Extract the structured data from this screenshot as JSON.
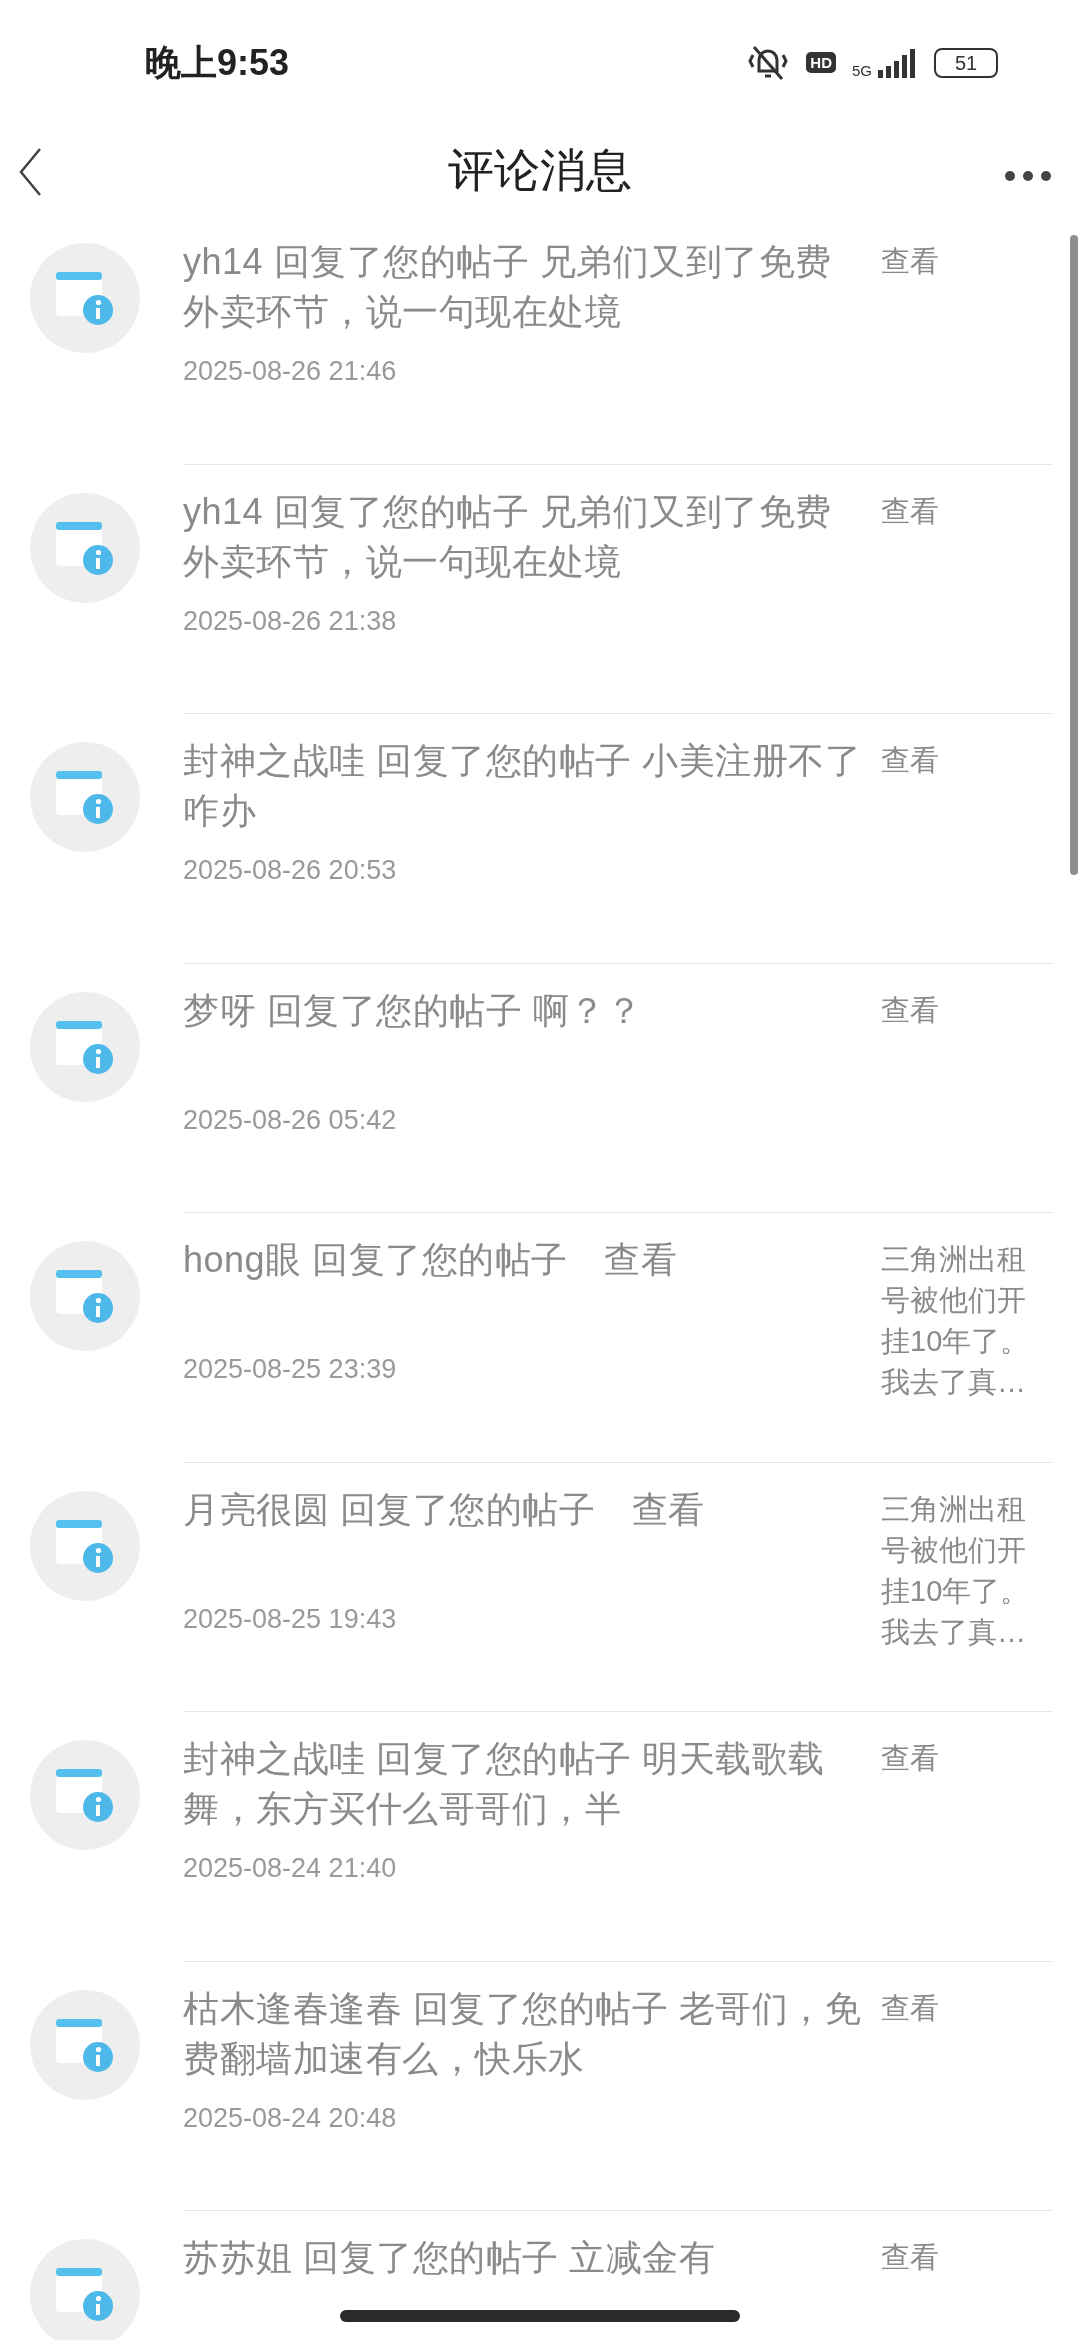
{
  "status_bar": {
    "time": "晚上9:53",
    "hd": "HD",
    "network": "5G",
    "battery": "51"
  },
  "header": {
    "title": "评论消息"
  },
  "messages": [
    {
      "text": "yh14 回复了您的帖子 兄弟们又到了免费外卖环节，说一句现在处境",
      "date": "2025-08-26 21:46",
      "side": "查看"
    },
    {
      "text": "yh14 回复了您的帖子 兄弟们又到了免费外卖环节，说一句现在处境",
      "date": "2025-08-26 21:38",
      "side": "查看"
    },
    {
      "text": "封神之战哇 回复了您的帖子 小美注册不了咋办",
      "date": "2025-08-26 20:53",
      "side": "查看"
    },
    {
      "text": "梦呀 回复了您的帖子 啊？？",
      "date": "2025-08-26 05:42",
      "side": "查看"
    },
    {
      "text": "hong眼 回复了您的帖子　查看",
      "date": "2025-08-25 23:39",
      "side": "三角洲出租号被他们开挂10年了。我去了真…"
    },
    {
      "text": "月亮很圆 回复了您的帖子　查看",
      "date": "2025-08-25 19:43",
      "side": "三角洲出租号被他们开挂10年了。我去了真…"
    },
    {
      "text": "封神之战哇 回复了您的帖子 明天载歌载舞，东方买什么哥哥们，半",
      "date": "2025-08-24 21:40",
      "side": "查看"
    },
    {
      "text": "枯木逢春逢春 回复了您的帖子 老哥们，免费翻墙加速有么，快乐水",
      "date": "2025-08-24 20:48",
      "side": "查看"
    },
    {
      "text": "苏苏姐 回复了您的帖子 立减金有",
      "side": "查看"
    }
  ]
}
